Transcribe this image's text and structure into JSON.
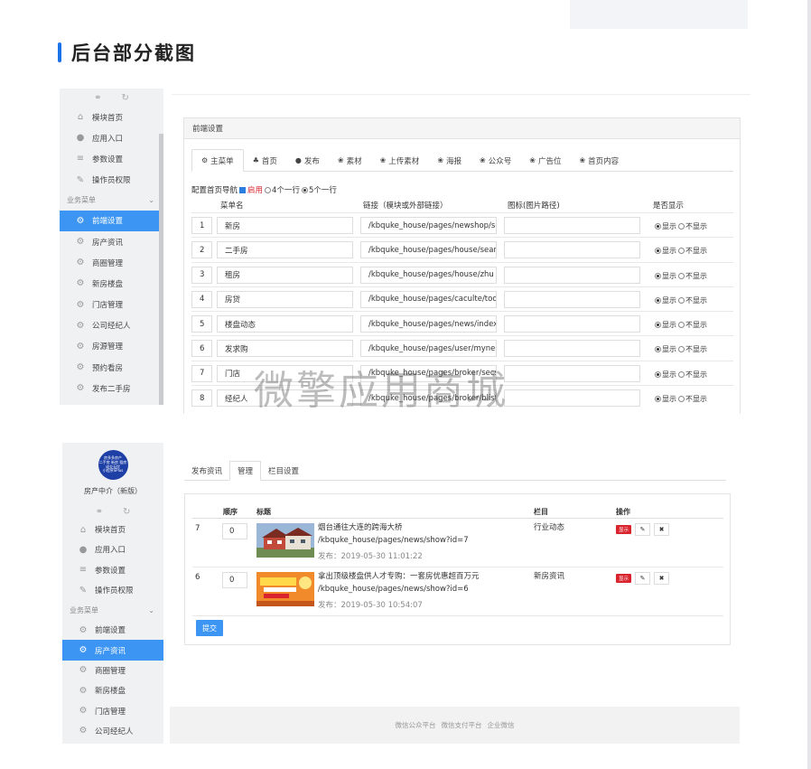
{
  "heading": "后台部分截图",
  "watermark": "微擎应用商城",
  "shot1": {
    "sidebar": {
      "top_items": [
        "模块首页",
        "应用入口",
        "参数设置",
        "操作员权限"
      ],
      "section_label": "业务菜单",
      "menu_items": [
        "前端设置",
        "房产资讯",
        "商圈管理",
        "新房楼盘",
        "门店管理",
        "公司经纪人",
        "房源管理",
        "预约看房",
        "发布二手房"
      ],
      "active_index": 0
    },
    "panel_title": "前端设置",
    "tabs": [
      "主菜单",
      "首页",
      "发布",
      "素材",
      "上传素材",
      "海报",
      "公众号",
      "广告位",
      "首页内容"
    ],
    "config": {
      "label": "配置首页导航",
      "enabled_label": "启用",
      "option1": "4个一行",
      "option2": "5个一行"
    },
    "columns": [
      "菜单名",
      "链接（模块或外部链接）",
      "图标(图片路径)",
      "是否显示"
    ],
    "show_label": "显示",
    "hide_label": "不显示",
    "rows": [
      {
        "no": "1",
        "name": "新房",
        "link": "/kbquke_house/pages/newshop/sear"
      },
      {
        "no": "2",
        "name": "二手房",
        "link": "/kbquke_house/pages/house/search"
      },
      {
        "no": "3",
        "name": "租房",
        "link": "/kbquke_house/pages/house/zhu"
      },
      {
        "no": "4",
        "name": "房贷",
        "link": "/kbquke_house/pages/caculte/toos"
      },
      {
        "no": "5",
        "name": "楼盘动态",
        "link": "/kbquke_house/pages/news/index"
      },
      {
        "no": "6",
        "name": "发求购",
        "link": "/kbquke_house/pages/user/myneed"
      },
      {
        "no": "7",
        "name": "门店",
        "link": "/kbquke_house/pages/broker/secshe"
      },
      {
        "no": "8",
        "name": "经纪人",
        "link": "/kbquke_house/pages/broker/blist"
      }
    ]
  },
  "shot2": {
    "sidebar": {
      "logo_lines": [
        "房多多房产",
        "二手房 新房 租房",
        "成交无忧",
        "小程序SPlus"
      ],
      "app_name": "房产中介（新版）",
      "top_items": [
        "模块首页",
        "应用入口",
        "参数设置",
        "操作员权限"
      ],
      "section_label": "业务菜单",
      "menu_items": [
        "前端设置",
        "房产资讯",
        "商圈管理",
        "新房楼盘",
        "门店管理",
        "公司经纪人"
      ],
      "active_index": 1
    },
    "tabs": [
      "发布资讯",
      "管理",
      "栏目设置"
    ],
    "active_tab": 1,
    "columns": [
      "顺序",
      "标题",
      "栏目",
      "操作"
    ],
    "show_badge": "显示",
    "rows": [
      {
        "id": "7",
        "order": "0",
        "title": "烟台通往大连的跨海大桥",
        "link": "/kbquke_house/pages/news/show?id=7",
        "date": "发布：2019-05-30 11:01:22",
        "category": "行业动态"
      },
      {
        "id": "6",
        "order": "0",
        "title": "拿出顶级楼盘供人才专购：一套房优惠超百万元",
        "link": "/kbquke_house/pages/news/show?id=6",
        "date": "发布：2019-05-30 10:54:07",
        "category": "新房资讯"
      }
    ],
    "submit_label": "提交",
    "footer_links": [
      "微信公众平台",
      "微信支付平台",
      "企业微信"
    ]
  }
}
